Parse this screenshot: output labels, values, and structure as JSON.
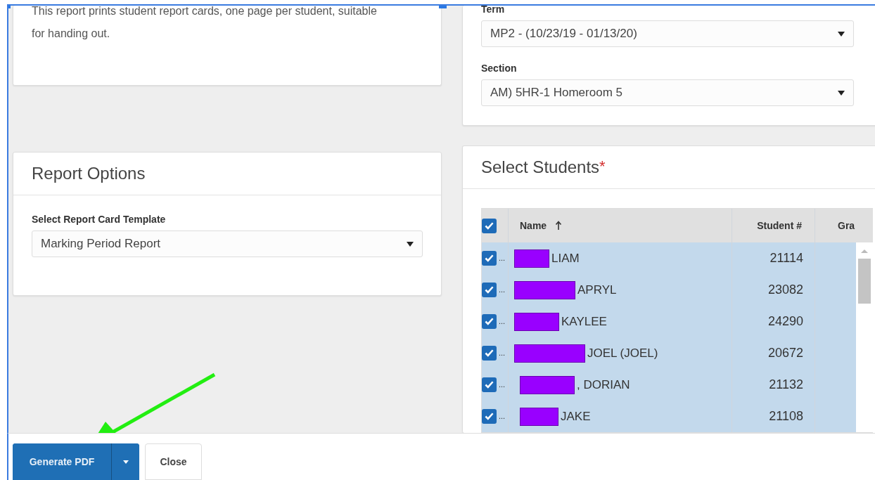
{
  "description": {
    "text": "This report prints student report cards, one page per student, suitable for handing out."
  },
  "term": {
    "label": "Term",
    "value": "MP2 - (10/23/19 - 01/13/20)"
  },
  "section": {
    "label": "Section",
    "value": "AM) 5HR-1 Homeroom 5"
  },
  "report_options": {
    "title": "Report Options",
    "template_label": "Select Report Card Template",
    "template_value": "Marking Period Report"
  },
  "select_students": {
    "title": "Select Students",
    "required_mark": "*",
    "all_checked": true,
    "columns": [
      {
        "label": "Name",
        "sorted": true
      },
      {
        "label": "Student #"
      },
      {
        "label": "Gra"
      }
    ],
    "rows": [
      {
        "checked": true,
        "marker": "...",
        "redacted": true,
        "name": "LIAM",
        "student_number": "21114",
        "selected": true
      },
      {
        "checked": true,
        "marker": "...",
        "redacted": true,
        "name": "APRYL",
        "student_number": "23082",
        "selected": true
      },
      {
        "checked": true,
        "marker": "...",
        "redacted": true,
        "name": "KAYLEE",
        "student_number": "24290",
        "selected": true
      },
      {
        "checked": true,
        "marker": "...",
        "redacted": true,
        "name": "JOEL (JOEL)",
        "student_number": "20672",
        "selected": true
      },
      {
        "checked": true,
        "marker": "...",
        "redacted": true,
        "name": ", DORIAN",
        "student_number": "21132",
        "selected": true
      },
      {
        "checked": true,
        "marker": "...",
        "redacted": true,
        "name": "JAKE",
        "student_number": "21108",
        "selected": true
      }
    ]
  },
  "footer": {
    "primary_button": "Generate PDF",
    "secondary_button": "Close"
  }
}
